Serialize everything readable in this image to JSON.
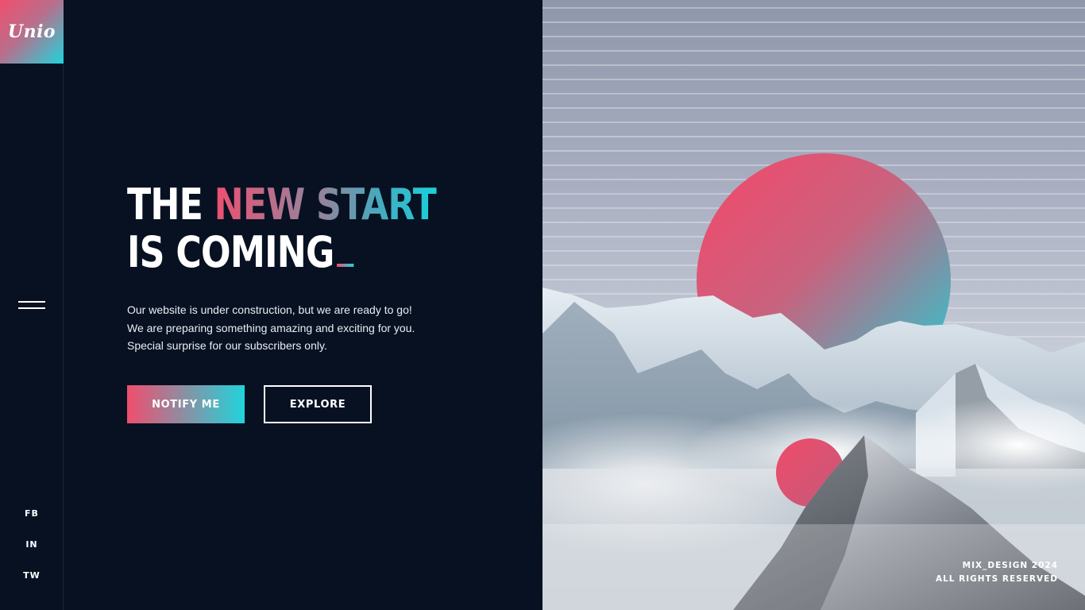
{
  "brand": {
    "logo_text": "Unio"
  },
  "sidebar": {
    "menu_icon": "hamburger-menu-icon",
    "socials": [
      "FB",
      "IN",
      "TW"
    ]
  },
  "hero": {
    "headline_line1_word1": "THE",
    "headline_line1_word2": "NEW",
    "headline_line1_word3": "START",
    "headline_line2": "IS COMING",
    "cursor": "_",
    "description": [
      "Our website is under construction, but we are ready to go!",
      "We are preparing something amazing and exciting for you.",
      "Special surprise for our subscribers only."
    ]
  },
  "buttons": {
    "notify_label": "NOTIFY ME",
    "explore_label": "EXPLORE"
  },
  "footer": {
    "line1": "MIX_DESIGN 2024",
    "line2": "ALL RIGHTS RESERVED"
  },
  "colors": {
    "background": "#071122",
    "accent_pink": "#f04e6e",
    "accent_cyan": "#20d4dc"
  }
}
